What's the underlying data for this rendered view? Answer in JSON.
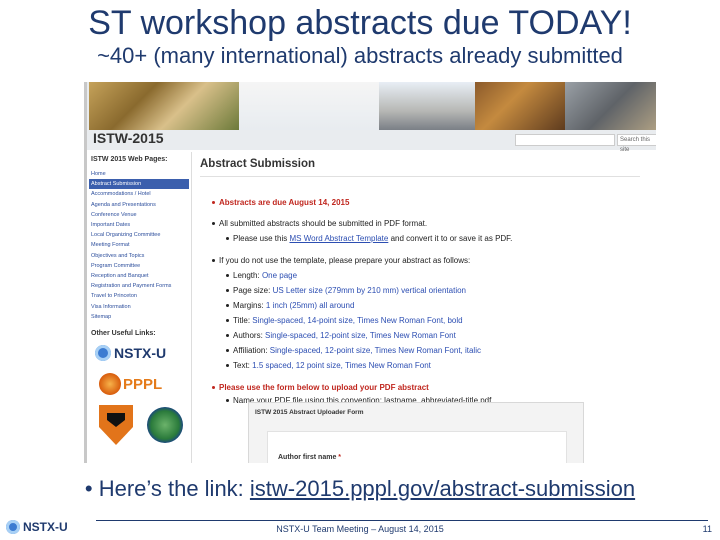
{
  "slide": {
    "title": "ST workshop abstracts due TODAY!",
    "subtitle": "~40+ (many international) abstracts already submitted",
    "bullet_prefix": "• Here’s the link:",
    "link_text": "istw-2015.pppl.gov/abstract-submission",
    "footer_logo": "NSTX-U",
    "footer_text": "NSTX-U Team Meeting – August 14, 2015",
    "page_number": "11"
  },
  "site": {
    "name": "ISTW-2015",
    "search_button": "Search this site",
    "nav_heading": "ISTW 2015 Web Pages:",
    "nav_items": [
      "Home",
      "Abstract Submission",
      "Accommodations / Hotel",
      "Agenda and Presentations",
      "Conference Venue",
      "Important Dates",
      "Local Organizing Committee",
      "Meeting Format",
      "Objectives and Topics",
      "Program Committee",
      "Reception and Banquet",
      "Registration and Payment Forms",
      "Travel to Princeton",
      "Visa Information",
      "Sitemap"
    ],
    "other_heading": "Other Useful Links:",
    "logo_nstx": "NSTX-U",
    "logo_pppl": "PPPL",
    "main_title": "Abstract Submission",
    "items": {
      "due": "Abstracts are due August 14, 2015",
      "pdf": "All submitted abstracts should be submitted in PDF format.",
      "use_prefix": "Please use this ",
      "use_link": "MS Word Abstract Template",
      "use_suffix": " and convert it to or save it as PDF.",
      "notemplate": "If you do not use the template, please prepare your abstract as follows:",
      "length_label": "Length:",
      "length_value": "One page",
      "page_label": "Page size:",
      "page_value": "US Letter size (279mm by 210 mm) vertical orientation",
      "margins_label": "Margins:",
      "margins_value": "1 inch (25mm) all around",
      "title_label": "Title:",
      "title_value": "Single-spaced, 14-point size, Times New Roman Font, bold",
      "authors_label": "Authors:",
      "authors_value": "Single-spaced, 12-point size, Times New Roman Font",
      "affil_label": "Affiliation:",
      "affil_value": "Single-spaced, 12-point size, Times New Roman Font, italic",
      "text_label": "Text:",
      "text_value": "1.5 spaced, 12 point size, Times New Roman Font",
      "upload": "Please use the form below to upload your PDF abstract",
      "name_file": "Name your PDF file using this convention: lastname_abbreviated-title.pdf"
    },
    "form_title": "ISTW 2015 Abstract Uploader Form",
    "form_field_label": "Author first name",
    "form_required_mark": "*"
  }
}
